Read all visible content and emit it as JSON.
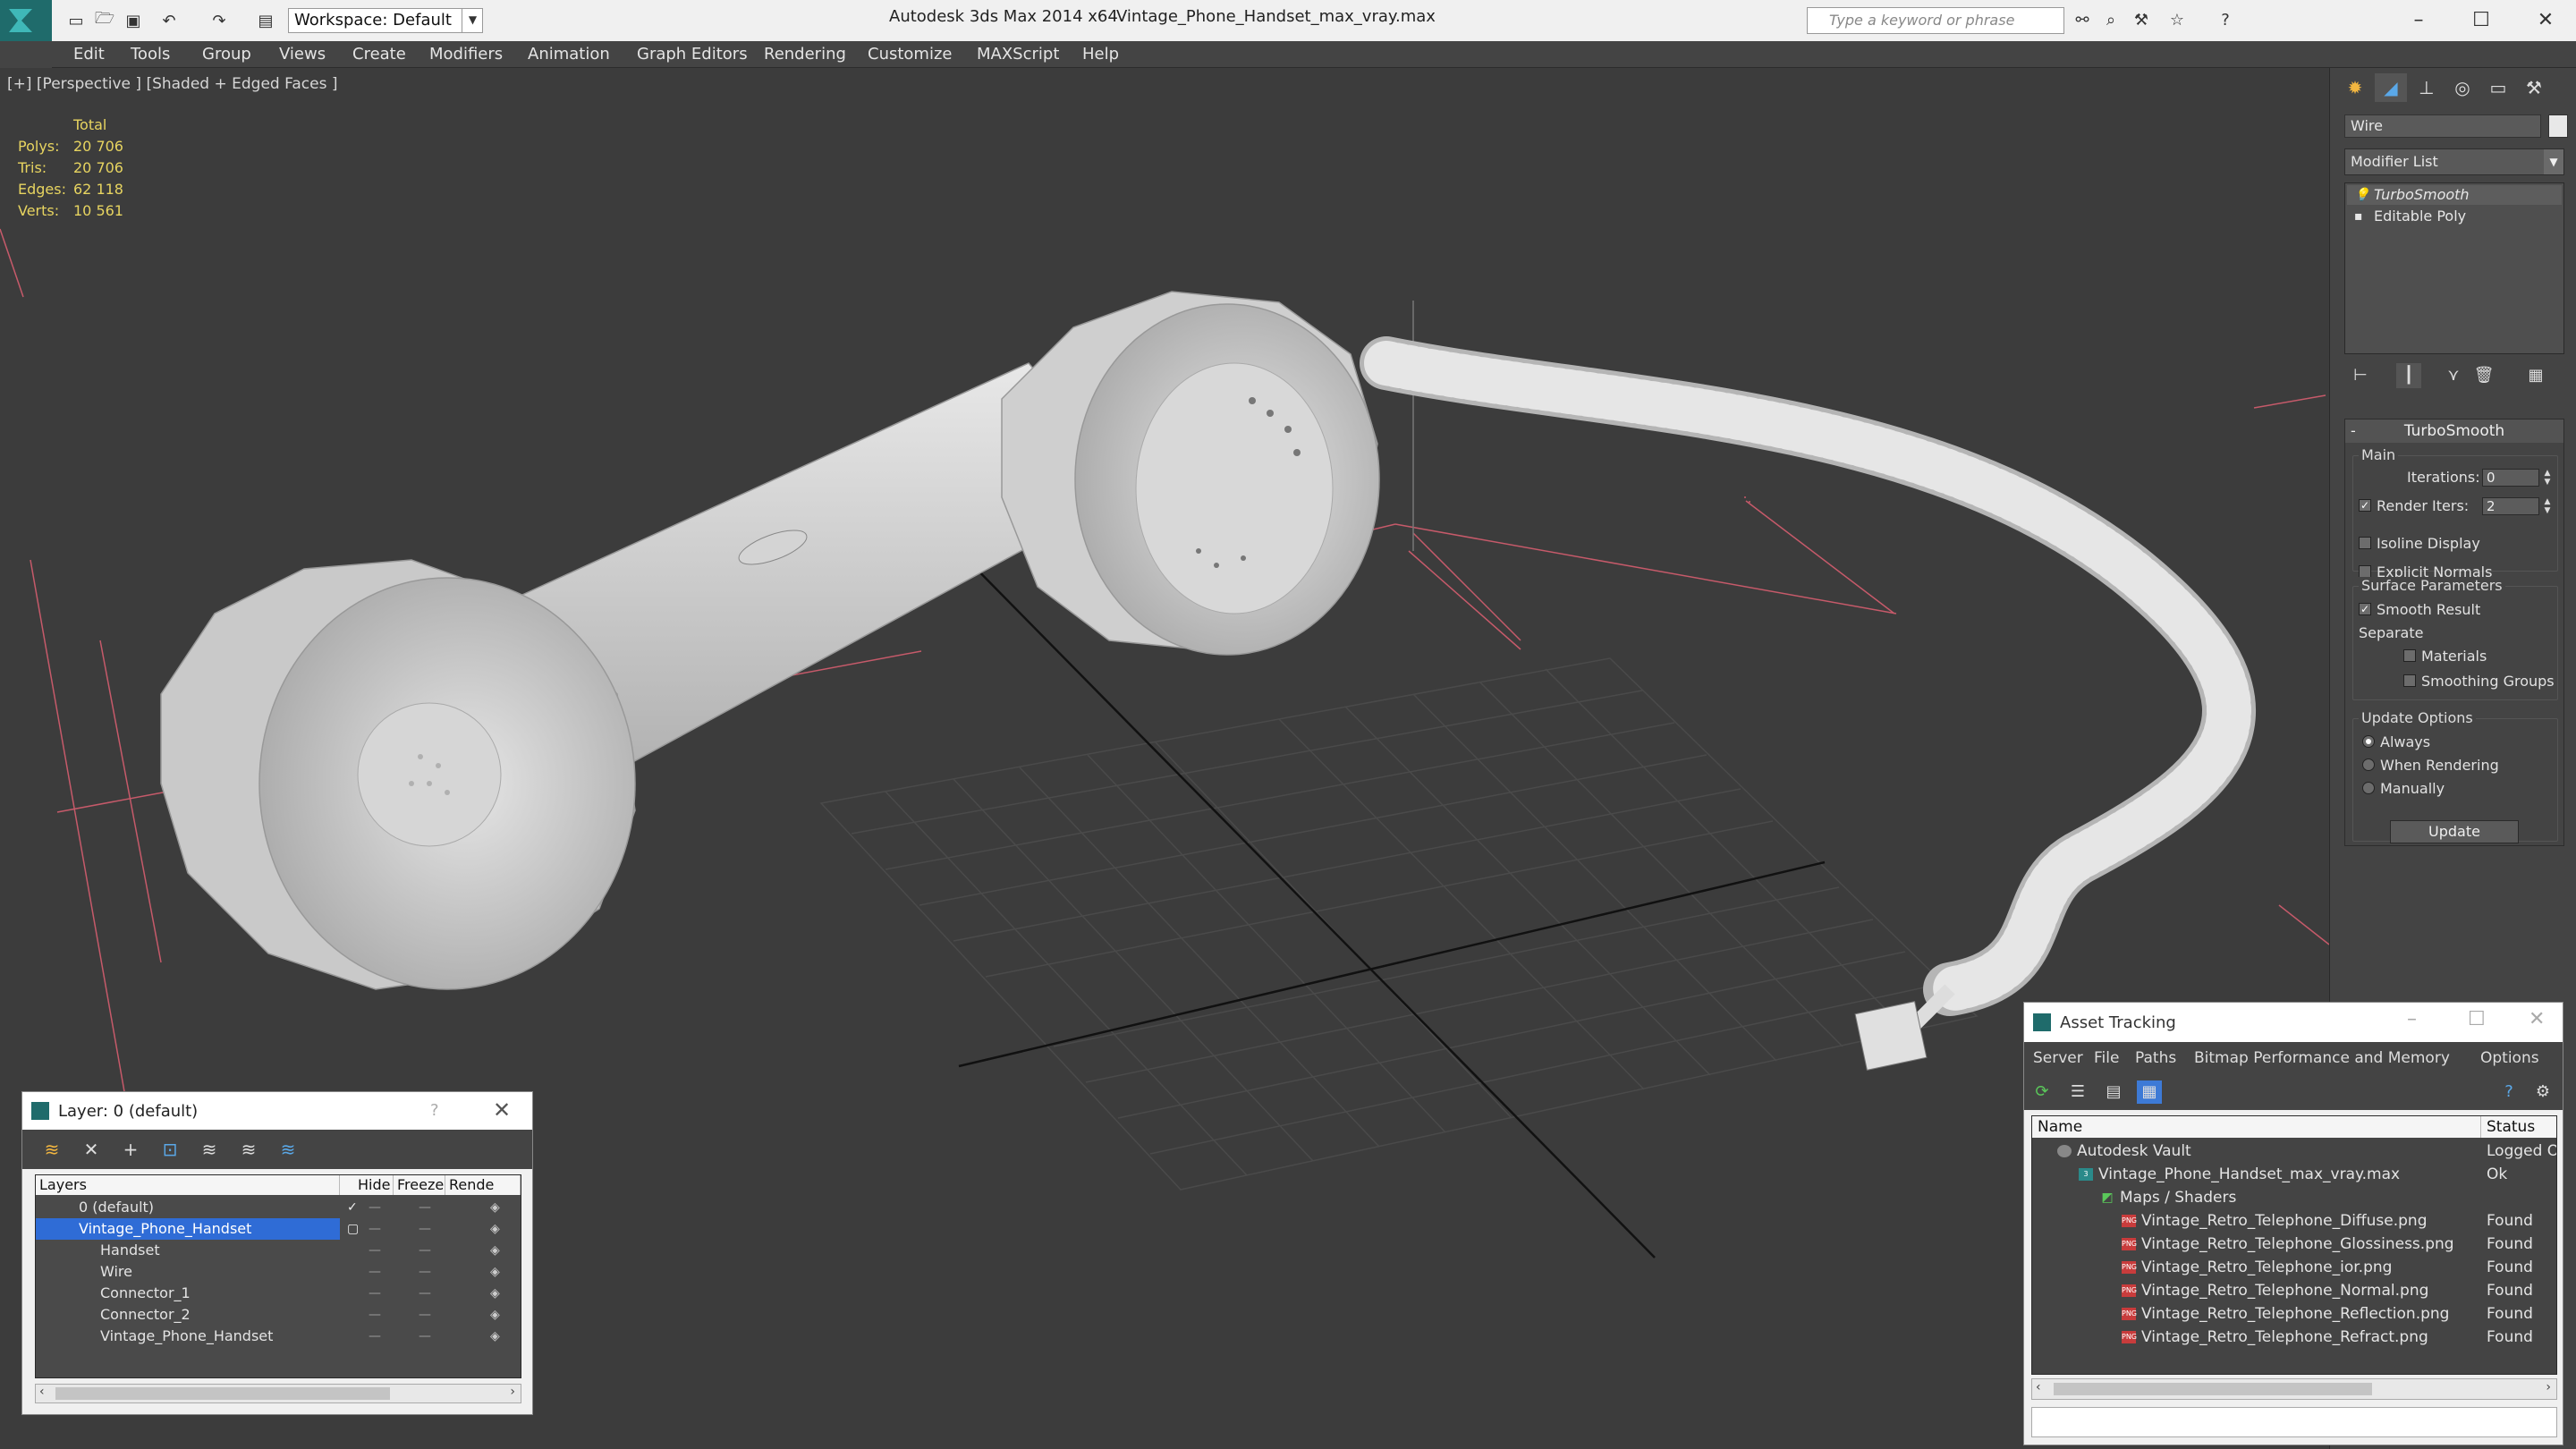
{
  "titlebar": {
    "workspace": "Workspace: Default",
    "app": "Autodesk 3ds Max  2014 x64",
    "document": "Vintage_Phone_Handset_max_vray.max",
    "search_placeholder": "Type a keyword or phrase"
  },
  "menu": [
    "Edit",
    "Tools",
    "Group",
    "Views",
    "Create",
    "Modifiers",
    "Animation",
    "Graph Editors",
    "Rendering",
    "Customize",
    "MAXScript",
    "Help"
  ],
  "viewport": {
    "label": "[+] [Perspective ] [Shaded + Edged Faces ]",
    "stats": {
      "header": "Total",
      "rows": [
        {
          "k": "Polys:",
          "v": "20 706"
        },
        {
          "k": "Tris:",
          "v": "20 706"
        },
        {
          "k": "Edges:",
          "v": "62 118"
        },
        {
          "k": "Verts:",
          "v": "10 561"
        }
      ]
    }
  },
  "command_panel": {
    "object_name": "Wire",
    "object_color": "#e8e8e8",
    "modifier_list": "Modifier List",
    "stack": [
      "TurboSmooth",
      "Editable Poly"
    ],
    "rollout": {
      "title": "TurboSmooth",
      "main": "Main",
      "iterations_label": "Iterations:",
      "iterations": "0",
      "render_iters_label": "Render Iters:",
      "render_iters": "2",
      "isoline": "Isoline Display",
      "explicit_normals": "Explicit Normals",
      "surface_params": "Surface Parameters",
      "smooth_result": "Smooth Result",
      "separate": "Separate",
      "materials": "Materials",
      "smoothing_groups": "Smoothing Groups",
      "update_options": "Update Options",
      "always": "Always",
      "when_rendering": "When Rendering",
      "manually": "Manually",
      "update": "Update"
    }
  },
  "layer_dialog": {
    "title": "Layer: 0 (default)",
    "help": "?",
    "columns": [
      "Layers",
      "Hide",
      "Freeze",
      "Rende"
    ],
    "rows": [
      {
        "name": "0 (default)"
      },
      {
        "name": "Vintage_Phone_Handset"
      },
      {
        "name": "Handset"
      },
      {
        "name": "Wire"
      },
      {
        "name": "Connector_1"
      },
      {
        "name": "Connector_2"
      },
      {
        "name": "Vintage_Phone_Handset"
      }
    ]
  },
  "asset_dialog": {
    "title": "Asset Tracking",
    "menu": [
      "Server",
      "File",
      "Paths",
      "Bitmap Performance and Memory",
      "Options"
    ],
    "columns": [
      "Name",
      "Status"
    ],
    "rows": [
      {
        "name": "Autodesk Vault",
        "status": "Logged O"
      },
      {
        "name": "Vintage_Phone_Handset_max_vray.max",
        "status": "Ok"
      },
      {
        "name": "Maps / Shaders",
        "status": ""
      },
      {
        "name": "Vintage_Retro_Telephone_Diffuse.png",
        "status": "Found"
      },
      {
        "name": "Vintage_Retro_Telephone_Glossiness.png",
        "status": "Found"
      },
      {
        "name": "Vintage_Retro_Telephone_ior.png",
        "status": "Found"
      },
      {
        "name": "Vintage_Retro_Telephone_Normal.png",
        "status": "Found"
      },
      {
        "name": "Vintage_Retro_Telephone_Reflection.png",
        "status": "Found"
      },
      {
        "name": "Vintage_Retro_Telephone_Refract.png",
        "status": "Found"
      }
    ]
  },
  "colors": {
    "accent": "#1f6b6b",
    "stats": "#e7d460",
    "selection": "#2f6cd6"
  }
}
